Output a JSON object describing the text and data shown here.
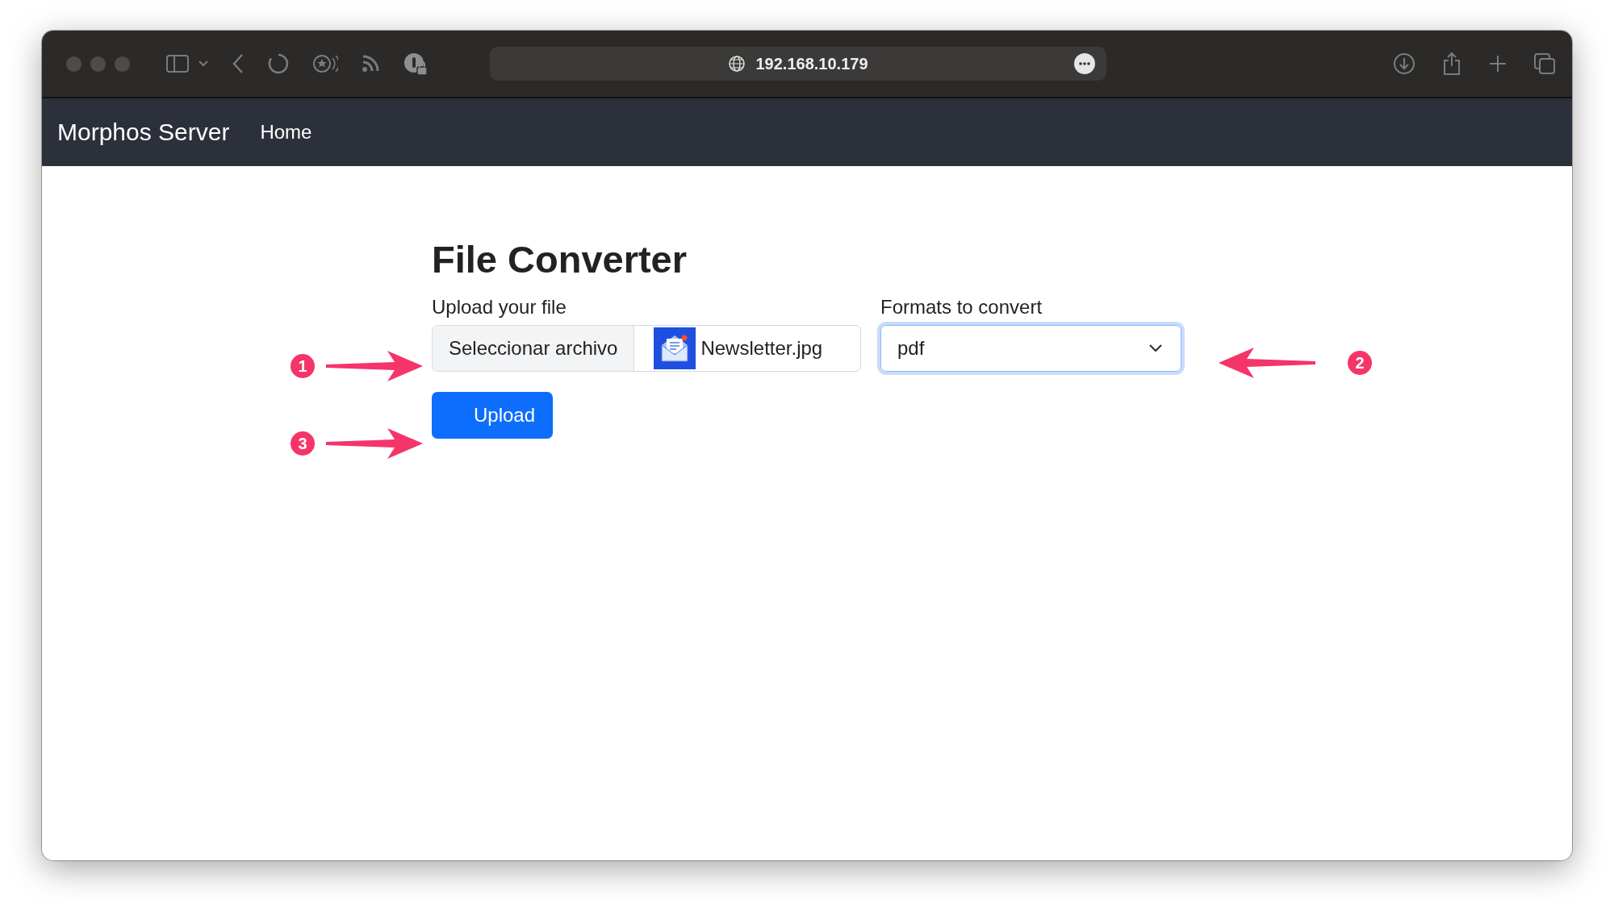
{
  "browser": {
    "address": "192.168.10.179"
  },
  "navbar": {
    "brand": "Morphos Server",
    "links": [
      {
        "label": "Home"
      }
    ]
  },
  "page": {
    "title": "File Converter",
    "upload": {
      "label": "Upload your file",
      "button": "Seleccionar archivo",
      "file_name": "Newsletter.jpg"
    },
    "format": {
      "label": "Formats to convert",
      "value": "pdf",
      "focused": true
    },
    "submit": "Upload"
  },
  "annotations": [
    {
      "number": "1",
      "kind": "rightarrow"
    },
    {
      "number": "2",
      "kind": "leftarrow"
    },
    {
      "number": "3",
      "kind": "rightarrow"
    }
  ]
}
